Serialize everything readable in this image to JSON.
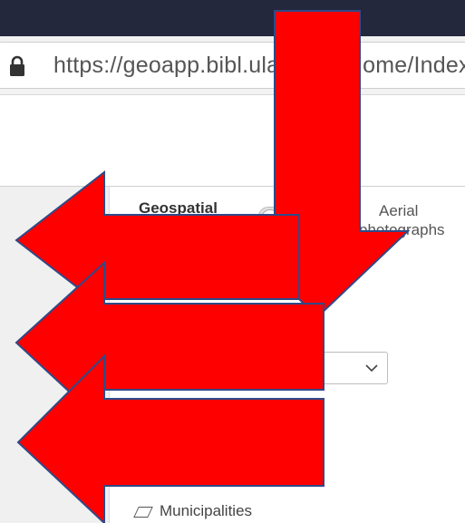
{
  "browser": {
    "url_text": "https://geoapp.bibl.ulaval.ca/Home/Index"
  },
  "tabs": {
    "geospatial_label": "Geospatial",
    "aerial_line1": "Aerial",
    "aerial_line2": "photographs"
  },
  "layers": {
    "municipalities_label": "Municipalities"
  },
  "annotation": {
    "arrow_color": "#ff0000",
    "arrow_outline": "#2f4a88"
  }
}
